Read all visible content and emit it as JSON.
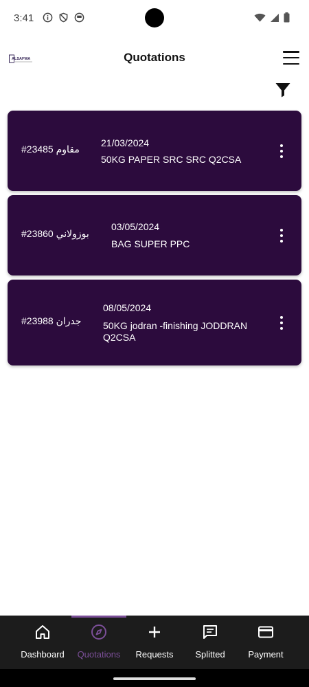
{
  "status_bar": {
    "time": "3:41",
    "icons_left": [
      "info-icon",
      "shield-icon",
      "sim-icon"
    ],
    "icons_right": [
      "wifi-icon",
      "signal-icon",
      "battery-icon"
    ]
  },
  "app_bar": {
    "logo_text": "ALSAFWA",
    "title": "Quotations",
    "menu_icon": "hamburger-menu-icon",
    "filter_icon": "filter-icon"
  },
  "quotations": [
    {
      "id": "#23485 مقاوم",
      "date": "21/03/2024",
      "description": "50KG PAPER SRC  SRC  Q2CSA"
    },
    {
      "id": "#23860 بوزولاني",
      "date": "03/05/2024",
      "description": "BAG SUPER PPC"
    },
    {
      "id": "#23988 جدران",
      "date": "08/05/2024",
      "description": "50KG jodran -finishing  JODDRAN Q2CSA"
    }
  ],
  "bottom_nav": {
    "active": "Quotations",
    "items": [
      {
        "label": "Dashboard",
        "icon": "home-icon"
      },
      {
        "label": "Quotations",
        "icon": "compass-icon"
      },
      {
        "label": "Requests",
        "icon": "plus-icon"
      },
      {
        "label": "Splitted",
        "icon": "message-icon"
      },
      {
        "label": "Payment",
        "icon": "credit-card-icon"
      }
    ]
  },
  "colors": {
    "card_bg": "#2c0b3d",
    "accent": "#7b4f98",
    "nav_bg": "#1c1c1c"
  }
}
